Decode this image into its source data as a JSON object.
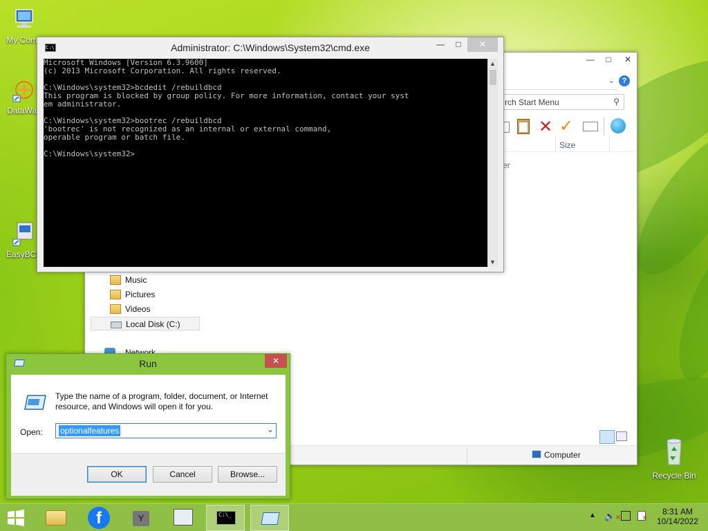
{
  "desktop": {
    "icons": [
      {
        "label": "My Comp"
      },
      {
        "label": "DataWag"
      },
      {
        "label": "EasyBCD"
      },
      {
        "label": "Recycle Bin"
      }
    ]
  },
  "cmd": {
    "title": "Administrator: C:\\Windows\\System32\\cmd.exe",
    "lines": [
      "Microsoft Windows [Version 6.3.9600]",
      "(c) 2013 Microsoft Corporation. All rights reserved.",
      "",
      "C:\\Windows\\system32>bcdedit /rebuildbcd",
      "This program is blocked by group policy. For more information, contact your syst",
      "em administrator.",
      "",
      "C:\\Windows\\system32>bootrec /rebuildbcd",
      "'bootrec' is not recognized as an internal or external command,",
      "operable program or batch file.",
      "",
      "C:\\Windows\\system32>"
    ]
  },
  "explorer": {
    "search_placeholder": "rch Start Menu",
    "column_size": "Size",
    "partial_item": "er",
    "tree": [
      "Music",
      "Pictures",
      "Videos",
      "Local Disk (C:)",
      "Network"
    ],
    "status_location": "Computer"
  },
  "run": {
    "title": "Run",
    "description_line1": "Type the name of a program, folder, document, or Internet",
    "description_line2": "resource, and Windows will open it for you.",
    "open_label": "Open:",
    "open_value": "optionalfeatures",
    "ok": "OK",
    "cancel": "Cancel",
    "browse": "Browse..."
  },
  "taskbar": {
    "clock_time": "8:31 AM",
    "clock_date": "10/14/2022",
    "yahoo_letter": "Y",
    "cmd_thumb_text": "C:\\_"
  },
  "colors": {
    "run_frame": "#8cc63e",
    "taskbar": "#8fbf45",
    "selection": "#3399ff",
    "close_red": "#c75050"
  }
}
